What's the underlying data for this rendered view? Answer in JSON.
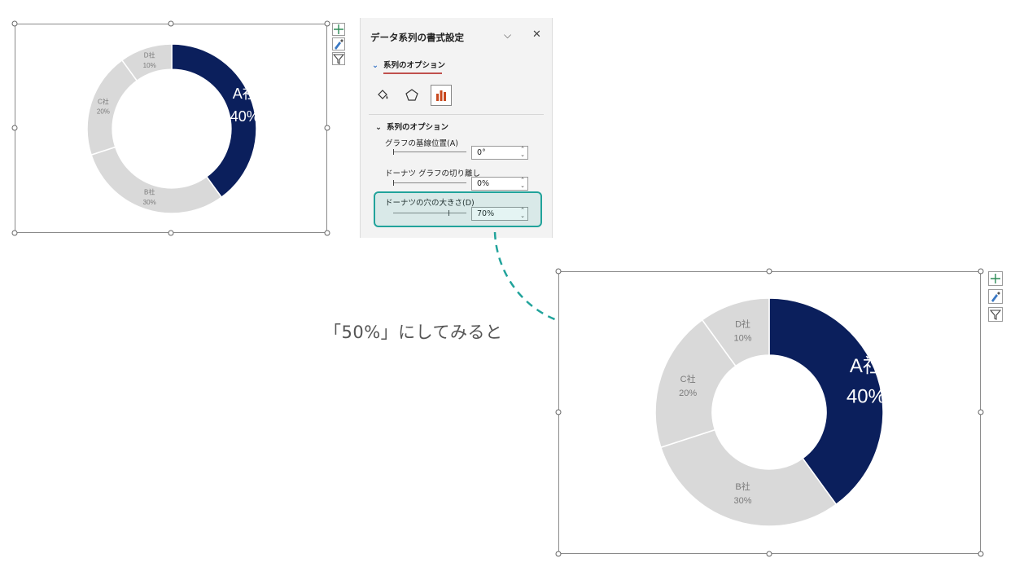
{
  "pane": {
    "title": "データ系列の書式設定",
    "section_tab": "系列のオプション",
    "icons": [
      "paint-bucket-icon",
      "pentagon-icon",
      "bar-chart-icon"
    ],
    "subsection": "系列のオプション",
    "options": [
      {
        "label": "グラフの基線位置(A)",
        "value": "0°"
      },
      {
        "label": "ドーナツ グラフの切り離し",
        "value": "0%"
      },
      {
        "label": "ドーナツの穴の大きさ(D)",
        "value": "70%"
      }
    ]
  },
  "caption": "「50%」にしてみると",
  "colors": {
    "series_a": "#0b1f5c",
    "others": "#d9d9d9",
    "highlight": "#21a39b"
  },
  "chart_data": [
    {
      "type": "pie",
      "variant": "doughnut",
      "hole_size_percent": 70,
      "categories": [
        "A社",
        "B社",
        "C社",
        "D社"
      ],
      "values": [
        40,
        30,
        20,
        10
      ],
      "labels": [
        "40%",
        "30%",
        "20%",
        "10%"
      ]
    },
    {
      "type": "pie",
      "variant": "doughnut",
      "hole_size_percent": 50,
      "categories": [
        "A社",
        "B社",
        "C社",
        "D社"
      ],
      "values": [
        40,
        30,
        20,
        10
      ],
      "labels": [
        "40%",
        "30%",
        "20%",
        "10%"
      ]
    }
  ]
}
